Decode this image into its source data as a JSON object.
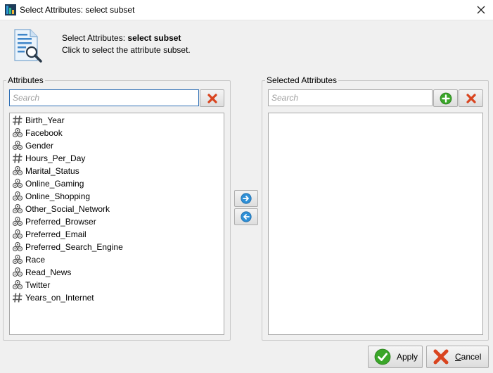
{
  "window": {
    "title": "Select Attributes: select subset",
    "close_glyph": "✕"
  },
  "header": {
    "line1_prefix": "Select Attributes: ",
    "line1_bold": "select subset",
    "line2": "Click to select the attribute subset."
  },
  "attributes_panel": {
    "title": "Attributes",
    "search_placeholder": "Search",
    "items": [
      {
        "label": "Birth_Year",
        "type": "numeric"
      },
      {
        "label": "Facebook",
        "type": "nominal"
      },
      {
        "label": "Gender",
        "type": "nominal"
      },
      {
        "label": "Hours_Per_Day",
        "type": "numeric"
      },
      {
        "label": "Marital_Status",
        "type": "nominal"
      },
      {
        "label": "Online_Gaming",
        "type": "nominal"
      },
      {
        "label": "Online_Shopping",
        "type": "nominal"
      },
      {
        "label": "Other_Social_Network",
        "type": "nominal"
      },
      {
        "label": "Preferred_Browser",
        "type": "nominal"
      },
      {
        "label": "Preferred_Email",
        "type": "nominal"
      },
      {
        "label": "Preferred_Search_Engine",
        "type": "nominal"
      },
      {
        "label": "Race",
        "type": "nominal"
      },
      {
        "label": "Read_News",
        "type": "nominal"
      },
      {
        "label": "Twitter",
        "type": "nominal"
      },
      {
        "label": "Years_on_Internet",
        "type": "numeric"
      }
    ]
  },
  "selected_panel": {
    "title": "Selected Attributes",
    "search_placeholder": "Search",
    "items": []
  },
  "buttons": {
    "apply": "Apply",
    "cancel_underlined": "C",
    "cancel_rest": "ancel"
  },
  "colors": {
    "red_x": "#d9441f",
    "green_plus": "#3aa629",
    "blue_arrow": "#2e8fd6",
    "focus_border": "#2f6fb4"
  },
  "icons": {
    "numeric": "hash-icon",
    "nominal": "nominal-dots-icon"
  }
}
